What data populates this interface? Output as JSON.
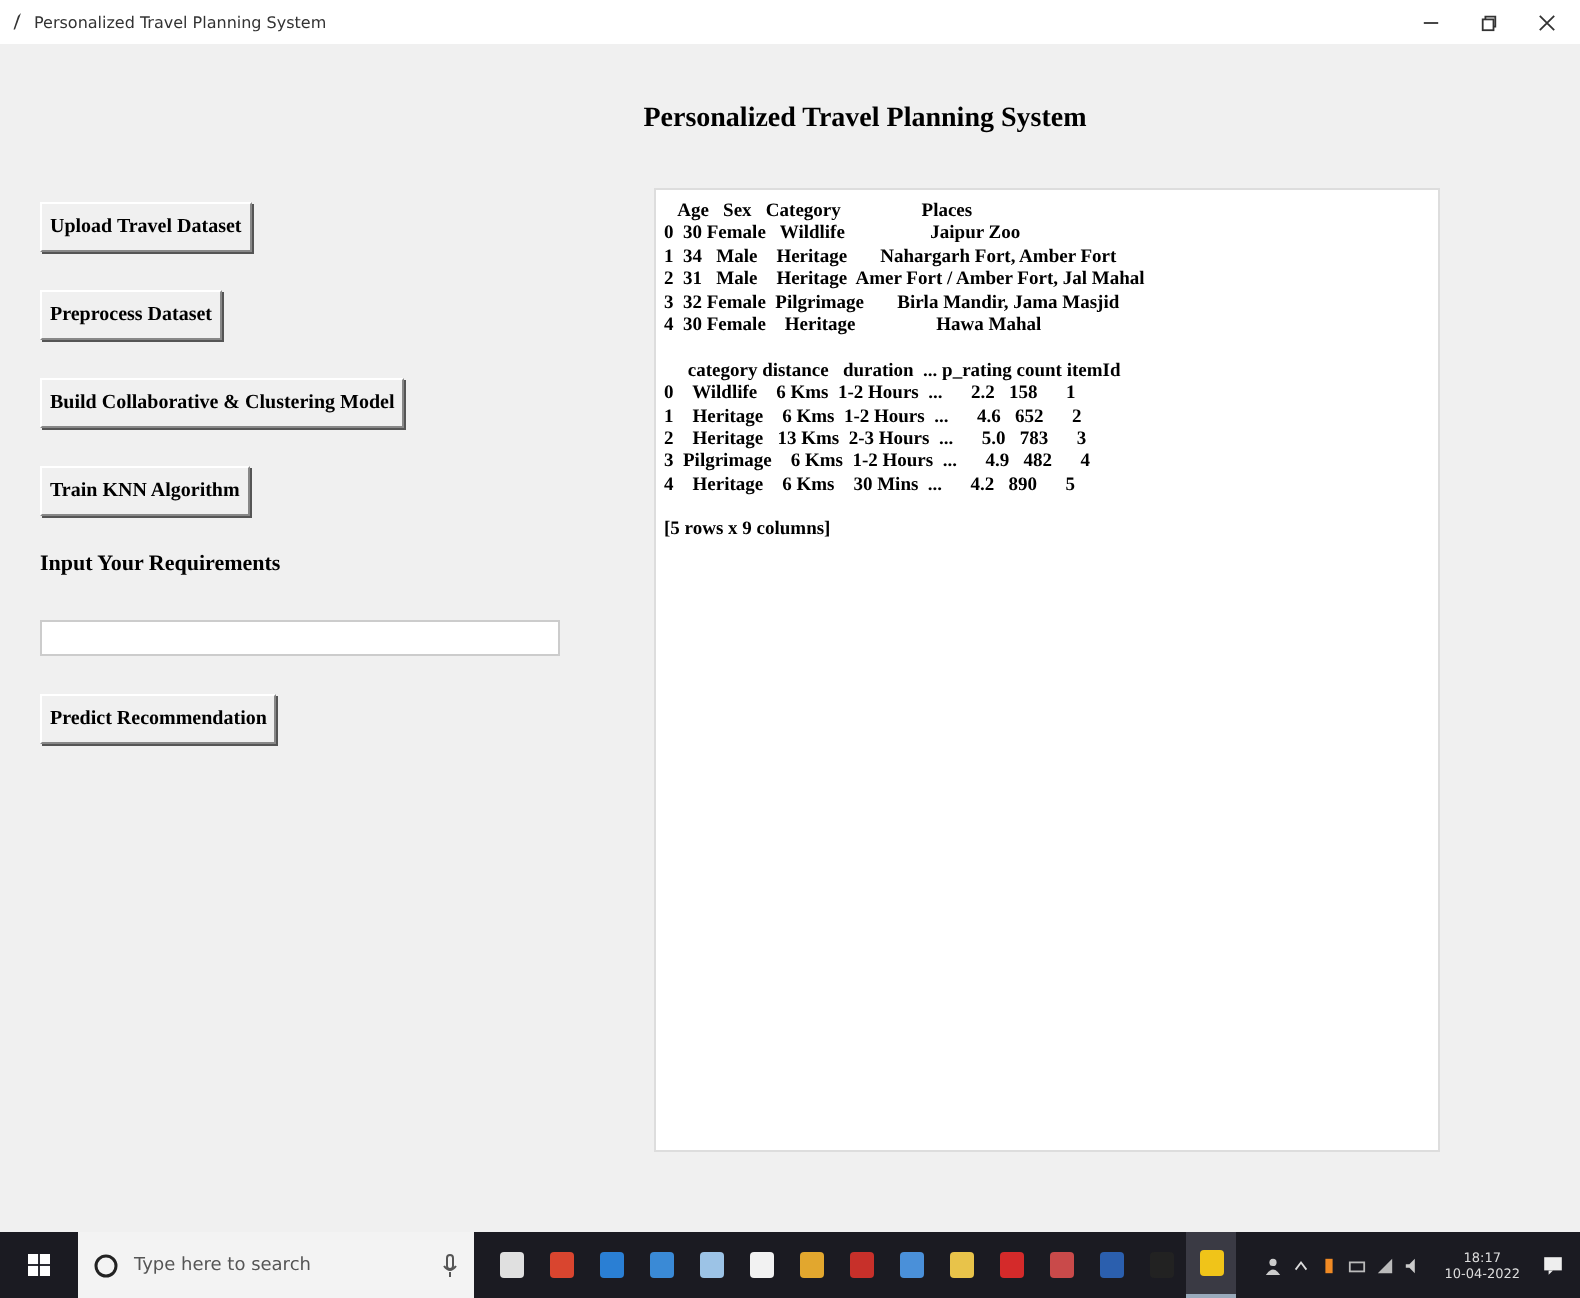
{
  "window": {
    "title": "Personalized Travel Planning System"
  },
  "heading": "Personalized Travel Planning System",
  "buttons": [
    {
      "label": "Upload Travel Dataset",
      "kind": "button"
    },
    {
      "label": "Preprocess Dataset",
      "kind": "button"
    },
    {
      "label": "Build Collaborative & Clustering Model",
      "kind": "button"
    },
    {
      "label": "Train KNN Algorithm",
      "kind": "button"
    },
    {
      "label": "Input Your Requirements",
      "kind": "label"
    },
    {
      "kind": "input"
    },
    {
      "label": "Predict Recommendation",
      "kind": "button"
    }
  ],
  "output": {
    "blocks": [
      {
        "lines": [
          "   Age   Sex   Category                 Places",
          "0  30 Female   Wildlife                  Jaipur Zoo",
          "1  34   Male    Heritage       Nahargarh Fort, Amber Fort",
          "2  31   Male    Heritage  Amer Fort / Amber Fort, Jal Mahal",
          "3  32 Female  Pilgrimage       Birla Mandir, Jama Masjid",
          "4  30 Female    Heritage                 Hawa Mahal"
        ]
      },
      {
        "lines": [
          "     category distance   duration  ... p_rating count itemId",
          "0    Wildlife    6 Kms  1-2 Hours  ...      2.2   158      1",
          "1    Heritage    6 Kms  1-2 Hours  ...      4.6   652      2",
          "2    Heritage   13 Kms  2-3 Hours  ...      5.0   783      3",
          "3  Pilgrimage    6 Kms  1-2 Hours  ...      4.9   482      4",
          "4    Heritage    6 Kms    30 Mins  ...      4.2   890      5"
        ]
      },
      {
        "lines": [
          "[5 rows x 9 columns]"
        ]
      }
    ]
  },
  "taskbar": {
    "search_placeholder": "Type here to search",
    "apps": [
      {
        "color": "#e0e0e0",
        "selected": false
      },
      {
        "color": "#d9452f",
        "selected": false
      },
      {
        "color": "#2a7fd4",
        "selected": false
      },
      {
        "color": "#3a8ad6",
        "selected": false
      },
      {
        "color": "#9cc3e6",
        "selected": false
      },
      {
        "color": "#f2f2f2",
        "selected": false
      },
      {
        "color": "#e2a72e",
        "selected": false
      },
      {
        "color": "#c7302a",
        "selected": false
      },
      {
        "color": "#4a90d9",
        "selected": false
      },
      {
        "color": "#e8c34a",
        "selected": false
      },
      {
        "color": "#d42a2a",
        "selected": false
      },
      {
        "color": "#c94a4a",
        "selected": false
      },
      {
        "color": "#2b5fae",
        "selected": false
      },
      {
        "color": "#222222",
        "selected": false
      },
      {
        "color": "#f0c419",
        "selected": true
      }
    ],
    "time": "18:17",
    "date": "10-04-2022"
  }
}
